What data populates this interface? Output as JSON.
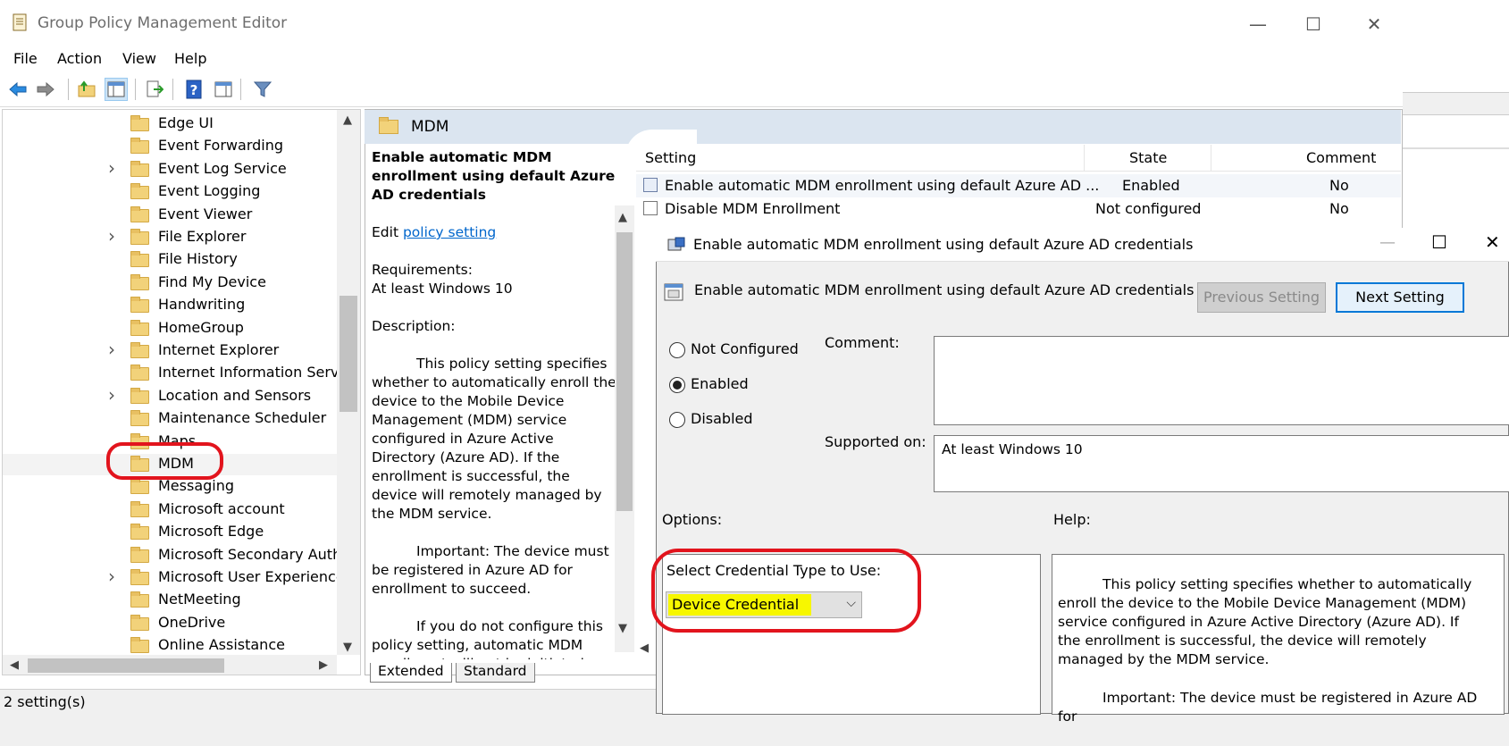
{
  "window": {
    "title": "Group Policy Management Editor",
    "minimize": "—",
    "maximize": "☐",
    "close": "✕"
  },
  "menu": [
    "File",
    "Action",
    "View",
    "Help"
  ],
  "toolbar": {
    "icons": [
      "back-icon",
      "forward-icon",
      "up-folder-icon",
      "show-hide-tree-icon",
      "export-list-icon",
      "help-icon",
      "show-hide-action-pane-icon",
      "filter-icon"
    ]
  },
  "tree": {
    "items": [
      {
        "label": "Edge UI",
        "expandable": false
      },
      {
        "label": "Event Forwarding",
        "expandable": false
      },
      {
        "label": "Event Log Service",
        "expandable": true
      },
      {
        "label": "Event Logging",
        "expandable": false
      },
      {
        "label": "Event Viewer",
        "expandable": false
      },
      {
        "label": "File Explorer",
        "expandable": true
      },
      {
        "label": "File History",
        "expandable": false
      },
      {
        "label": "Find My Device",
        "expandable": false
      },
      {
        "label": "Handwriting",
        "expandable": false
      },
      {
        "label": "HomeGroup",
        "expandable": false
      },
      {
        "label": "Internet Explorer",
        "expandable": true
      },
      {
        "label": "Internet Information Servic",
        "expandable": false
      },
      {
        "label": "Location and Sensors",
        "expandable": true
      },
      {
        "label": "Maintenance Scheduler",
        "expandable": false
      },
      {
        "label": "Maps",
        "expandable": false
      },
      {
        "label": "MDM",
        "expandable": false
      },
      {
        "label": "Messaging",
        "expandable": false
      },
      {
        "label": "Microsoft account",
        "expandable": false
      },
      {
        "label": "Microsoft Edge",
        "expandable": false
      },
      {
        "label": "Microsoft Secondary Auth",
        "expandable": false
      },
      {
        "label": "Microsoft User Experience '",
        "expandable": true
      },
      {
        "label": "NetMeeting",
        "expandable": false
      },
      {
        "label": "OneDrive",
        "expandable": false
      },
      {
        "label": "Online Assistance",
        "expandable": false
      }
    ]
  },
  "header": {
    "title": "MDM"
  },
  "description": {
    "title": "Enable automatic MDM enrollment using default Azure AD credentials",
    "edit_prefix": "Edit",
    "edit_link": "policy setting",
    "requirements_label": "Requirements:",
    "requirements_value": "At least Windows 10",
    "description_label": "Description:",
    "para1": "This policy setting specifies whether to automatically enroll the device to the Mobile Device Management (MDM) service configured in Azure Active Directory (Azure AD). If the enrollment is successful, the device will remotely managed by the MDM service.",
    "para2": "Important: The device must be registered in Azure AD for enrollment to succeed.",
    "para3": "If you do not configure this policy setting, automatic MDM enrollment will not be initiated."
  },
  "tabs": [
    "Extended",
    "Standard"
  ],
  "list": {
    "columns": [
      "Setting",
      "State",
      "Comment"
    ],
    "rows": [
      {
        "setting": "Enable automatic MDM enrollment using default Azure AD ...",
        "state": "Enabled",
        "comment": "No"
      },
      {
        "setting": "Disable MDM Enrollment",
        "state": "Not configured",
        "comment": "No"
      }
    ]
  },
  "status": {
    "text": "2 setting(s)"
  },
  "dialog": {
    "title": "Enable automatic MDM enrollment using default Azure AD credentials",
    "setting_name": "Enable automatic MDM enrollment using default Azure AD credentials",
    "prev_button": "Previous Setting",
    "next_button": "Next Setting",
    "radio": {
      "not_configured": "Not Configured",
      "enabled": "Enabled",
      "disabled": "Disabled",
      "selected": "Enabled"
    },
    "comment_label": "Comment:",
    "supported_label": "Supported on:",
    "supported_value": "At least Windows 10",
    "options_label": "Options:",
    "help_label": "Help:",
    "credential_label": "Select Credential Type to Use:",
    "credential_value": "Device Credential",
    "help_para1": "This policy setting specifies whether to automatically enroll the device to the Mobile Device Management (MDM) service configured in Azure Active Directory (Azure AD). If the enrollment is successful, the device will remotely managed by the MDM service.",
    "help_para2": "Important: The device must be registered in Azure AD for"
  },
  "colors": {
    "annotation": "#e2141d",
    "highlight": "#f7f700",
    "link": "#0066cc"
  }
}
